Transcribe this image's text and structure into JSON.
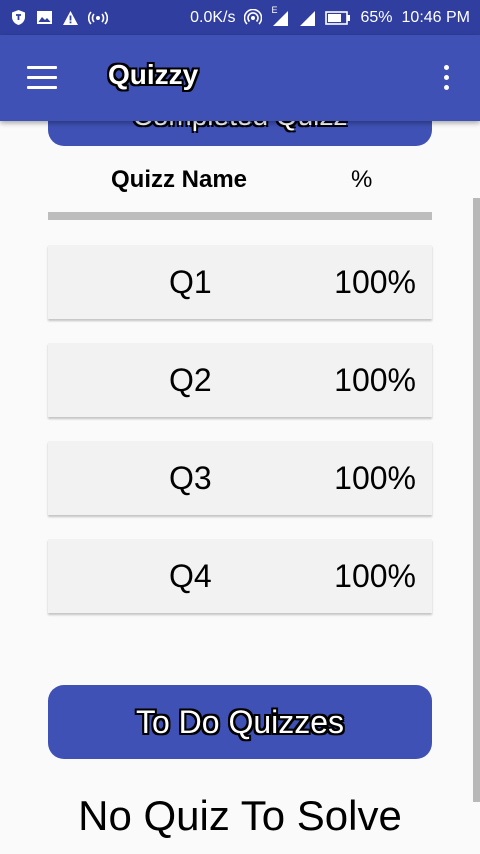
{
  "status_bar": {
    "net_speed": "0.0K/s",
    "battery": "65%",
    "time": "10:46 PM",
    "network_label": "E",
    "icons": [
      "shield-notification-icon",
      "image-notification-icon",
      "warning-icon",
      "broadcast-icon",
      "hotspot-icon",
      "signal-e-icon",
      "signal-icon",
      "battery-icon"
    ]
  },
  "app_bar": {
    "title": "Quizzy",
    "menu_icon": "hamburger-menu-icon",
    "overflow_icon": "more-vert-icon"
  },
  "completed_section": {
    "button_label": "Completed Quizz"
  },
  "table": {
    "headers": {
      "name": "Quizz Name",
      "percent": "%"
    },
    "rows": [
      {
        "name": "Q1",
        "percent": "100%"
      },
      {
        "name": "Q2",
        "percent": "100%"
      },
      {
        "name": "Q3",
        "percent": "100%"
      },
      {
        "name": "Q4",
        "percent": "100%"
      }
    ]
  },
  "todo_section": {
    "button_label": "To Do Quizzes",
    "empty_message": "No Quiz To Solve"
  },
  "colors": {
    "primary": "#3f51b5",
    "primary_dark": "#303f9f",
    "row_background": "#f2f2f2",
    "divider": "#bdbdbd"
  }
}
